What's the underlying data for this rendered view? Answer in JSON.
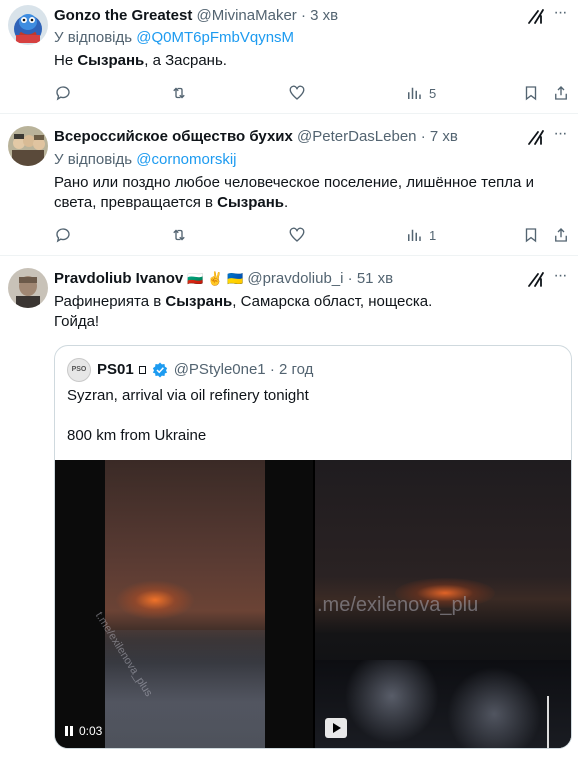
{
  "tweets": [
    {
      "name": "Gonzo the Greatest",
      "handle": "@MivinaMaker",
      "dot": "·",
      "time": "3 хв",
      "reply_prefix": "У відповідь",
      "reply_to": "@Q0MT6pFmbVqynsM",
      "text_parts": [
        "Не ",
        "Сызрань",
        ", а Засрань."
      ],
      "views": "5"
    },
    {
      "name": "Всероссийское общество бухих",
      "handle": "@PeterDasLeben",
      "dot": "·",
      "time": "7 хв",
      "reply_prefix": "У відповідь",
      "reply_to": "@cornomorskij",
      "text_line1": "Рано или поздно любое человеческое поселение, лишённое тепла и",
      "text_line2_parts": [
        "света, превращается в ",
        "Сызрань",
        "."
      ],
      "views": "1"
    },
    {
      "name": "Pravdoliub Ivanov",
      "flags": "🇧🇬 ✌️ 🇺🇦",
      "handle": "@pravdoliub_i",
      "dot": "·",
      "time": "51 хв",
      "text_line1_parts": [
        "Рафинерията в ",
        "Сызрань",
        ", Самарска област, нощеска."
      ],
      "text_line2": "Гойда!",
      "quote": {
        "avatar_text": "PSO",
        "name": "PS01",
        "handle": "@PStyle0ne1",
        "dot": "·",
        "time": "2 год",
        "line1": "Syzran, arrival via oil refinery tonight",
        "line2": "800 km from Ukraine",
        "video1_time": "0:03",
        "video1_watermark": "t.me/exilenova_plus",
        "video2_watermark": ".me/exilenova_plu"
      }
    }
  ],
  "icons": {
    "reply": "reply-icon",
    "retweet": "retweet-icon",
    "like": "heart-icon",
    "views": "views-icon",
    "bookmark": "bookmark-icon",
    "share": "share-icon",
    "grok": "grok-icon",
    "more": "more-icon",
    "verified": "verified-badge-icon"
  },
  "colors": {
    "link": "#1d9bf0",
    "secondary": "#536471",
    "text": "#0f1419",
    "border": "#cfd9de"
  }
}
